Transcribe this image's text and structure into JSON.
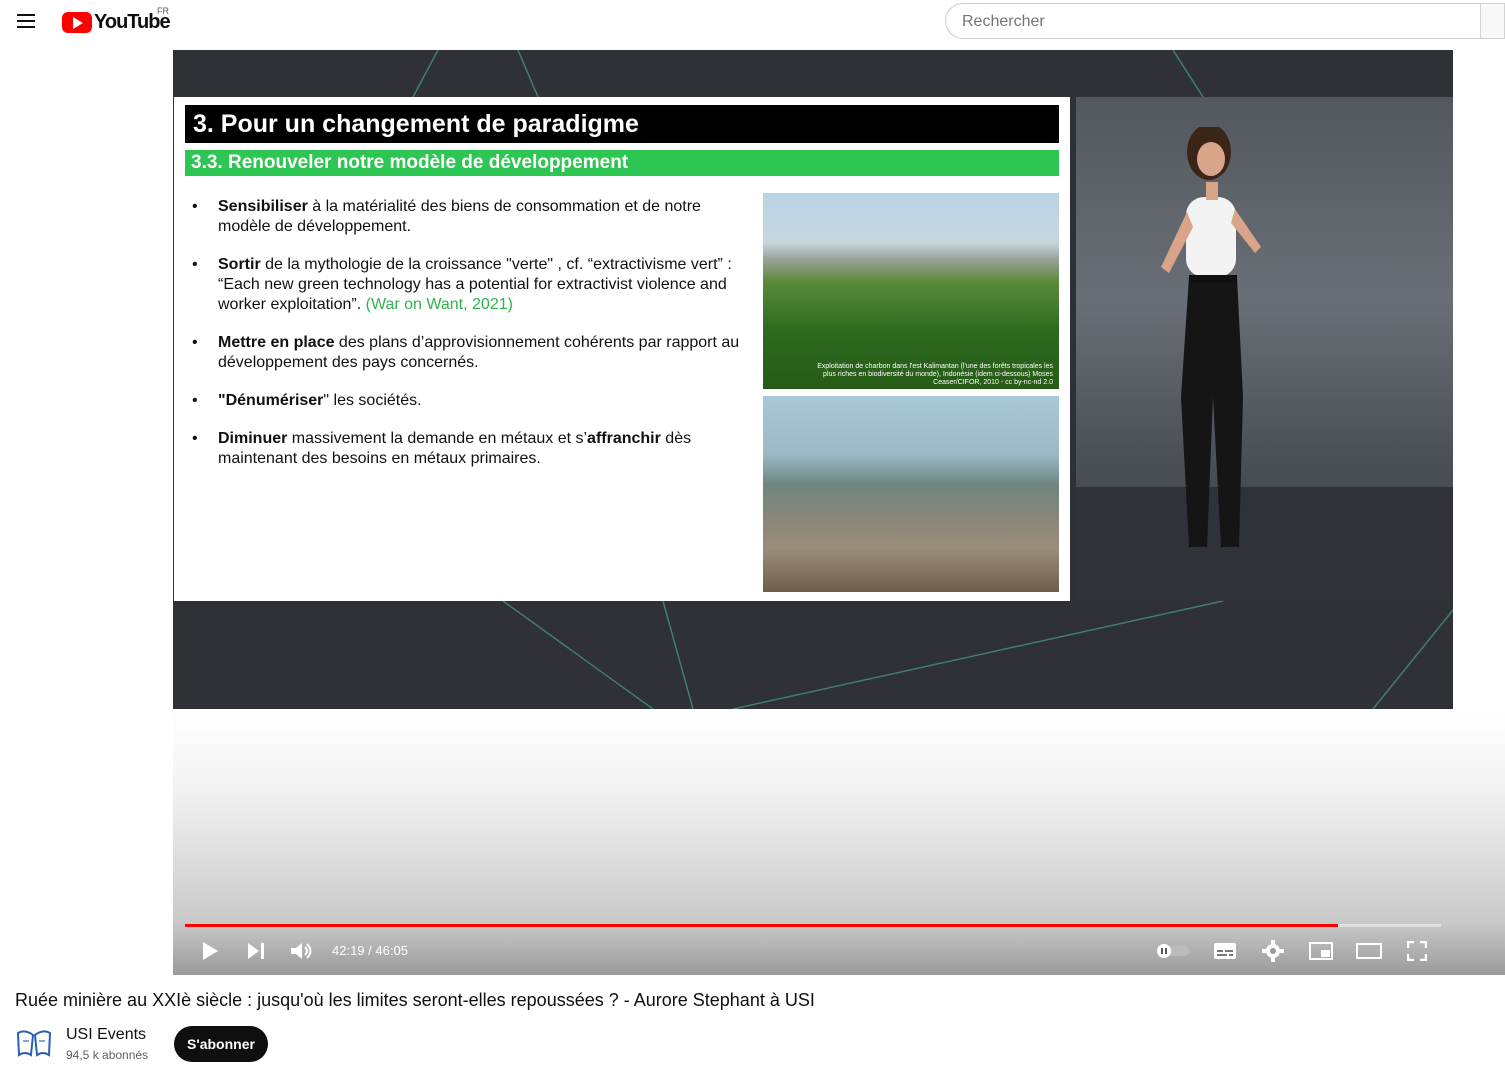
{
  "header": {
    "logo_text": "YouTube",
    "region": "FR",
    "search_placeholder": "Rechercher"
  },
  "slide": {
    "title": "3. Pour un changement de paradigme",
    "subtitle": "3.3. Renouveler notre modèle de développement",
    "bullets": [
      {
        "bold": "Sensibiliser",
        "text": " à la matérialité des biens de consommation et de notre modèle de développement."
      },
      {
        "bold": "Sortir",
        "text": " de la mythologie de la croissance \"verte\" , cf. “extractivisme vert” : “Each new green technology has a potential for extractivist violence and worker exploitation”. ",
        "cite": "(War on Want, 2021)"
      },
      {
        "bold": "Mettre en place",
        "text": " des plans d’approvisionnement cohérents par rapport au développement des pays concernés."
      },
      {
        "bold": "\"Dénumériser",
        "text": "\" les sociétés."
      },
      {
        "bold": "Diminuer",
        "text": " massivement la demande en métaux et s’",
        "bold2": "affranchir",
        "text2": " dès maintenant des besoins en métaux primaires."
      }
    ],
    "photo_caption": "Exploitation de charbon dans l'est Kalimantan (l'une des forêts tropicales les plus riches en biodiversité du monde), Indonésie (idem ci-dessous) Moses Ceaser/CIFOR, 2010 - cc by-nc-nd 2.0"
  },
  "player": {
    "current_time": "42:19",
    "separator": " / ",
    "duration": "46:05",
    "progress_fraction": 0.918
  },
  "video": {
    "title": "Ruée minière au XXIè siècle : jusqu'où les limites seront-elles repoussées ? - Aurore Stephant à USI"
  },
  "channel": {
    "name": "USI Events",
    "subscribers": "94,5 k abonnés",
    "subscribe_label": "S'abonner"
  },
  "colors": {
    "brand_red": "#ff0000",
    "slide_green": "#2dc653"
  }
}
